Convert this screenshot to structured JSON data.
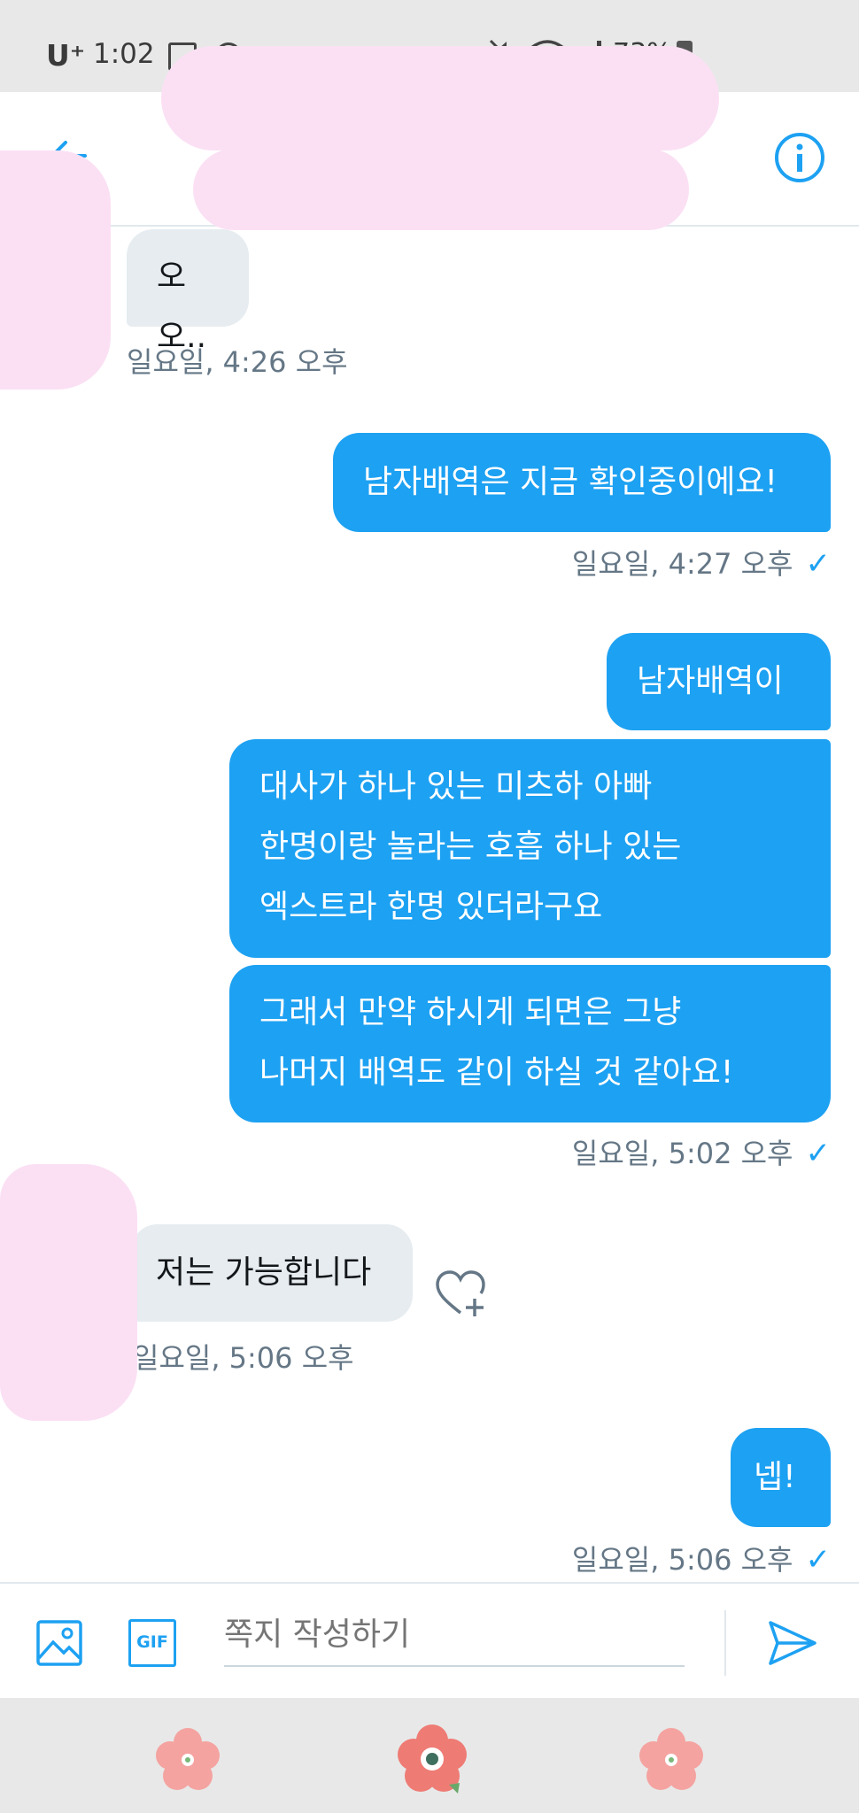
{
  "status_bar": {
    "carrier": "U⁺",
    "time": "1:02",
    "battery": "73%"
  },
  "header": {
    "back_icon": "arrow-left-icon",
    "info_icon": "info-icon"
  },
  "messages": [
    {
      "id": "m1",
      "direction": "in",
      "text": "오오..",
      "timestamp": "일요일, 4:26 오후"
    },
    {
      "id": "m2",
      "direction": "out",
      "text": "남자배역은 지금 확인중이에요!",
      "timestamp": "일요일, 4:27 오후"
    },
    {
      "id": "m3",
      "direction": "out",
      "text": "남자배역이"
    },
    {
      "id": "m4",
      "direction": "out",
      "lines": [
        "대사가 하나 있는 미츠하 아빠",
        "한명이랑 놀라는 호흡 하나 있는",
        "엑스트라 한명 있더라구요"
      ]
    },
    {
      "id": "m5",
      "direction": "out",
      "lines": [
        "그래서 만약 하시게 되면은 그냥",
        "나머지 배역도 같이 하실 것 같아요!"
      ],
      "timestamp": "일요일, 5:02 오후"
    },
    {
      "id": "m6",
      "direction": "in",
      "text": "저는 가능합니다",
      "timestamp": "일요일, 5:06 오후"
    },
    {
      "id": "m7",
      "direction": "out",
      "text": "넵!",
      "timestamp": "일요일, 5:06 오후"
    }
  ],
  "composer": {
    "placeholder": "쪽지 작성하기",
    "gif_label": "GIF"
  },
  "colors": {
    "accent": "#1da1f2",
    "incoming_bubble": "#e6ecf0",
    "redaction": "#fbe0f4"
  }
}
